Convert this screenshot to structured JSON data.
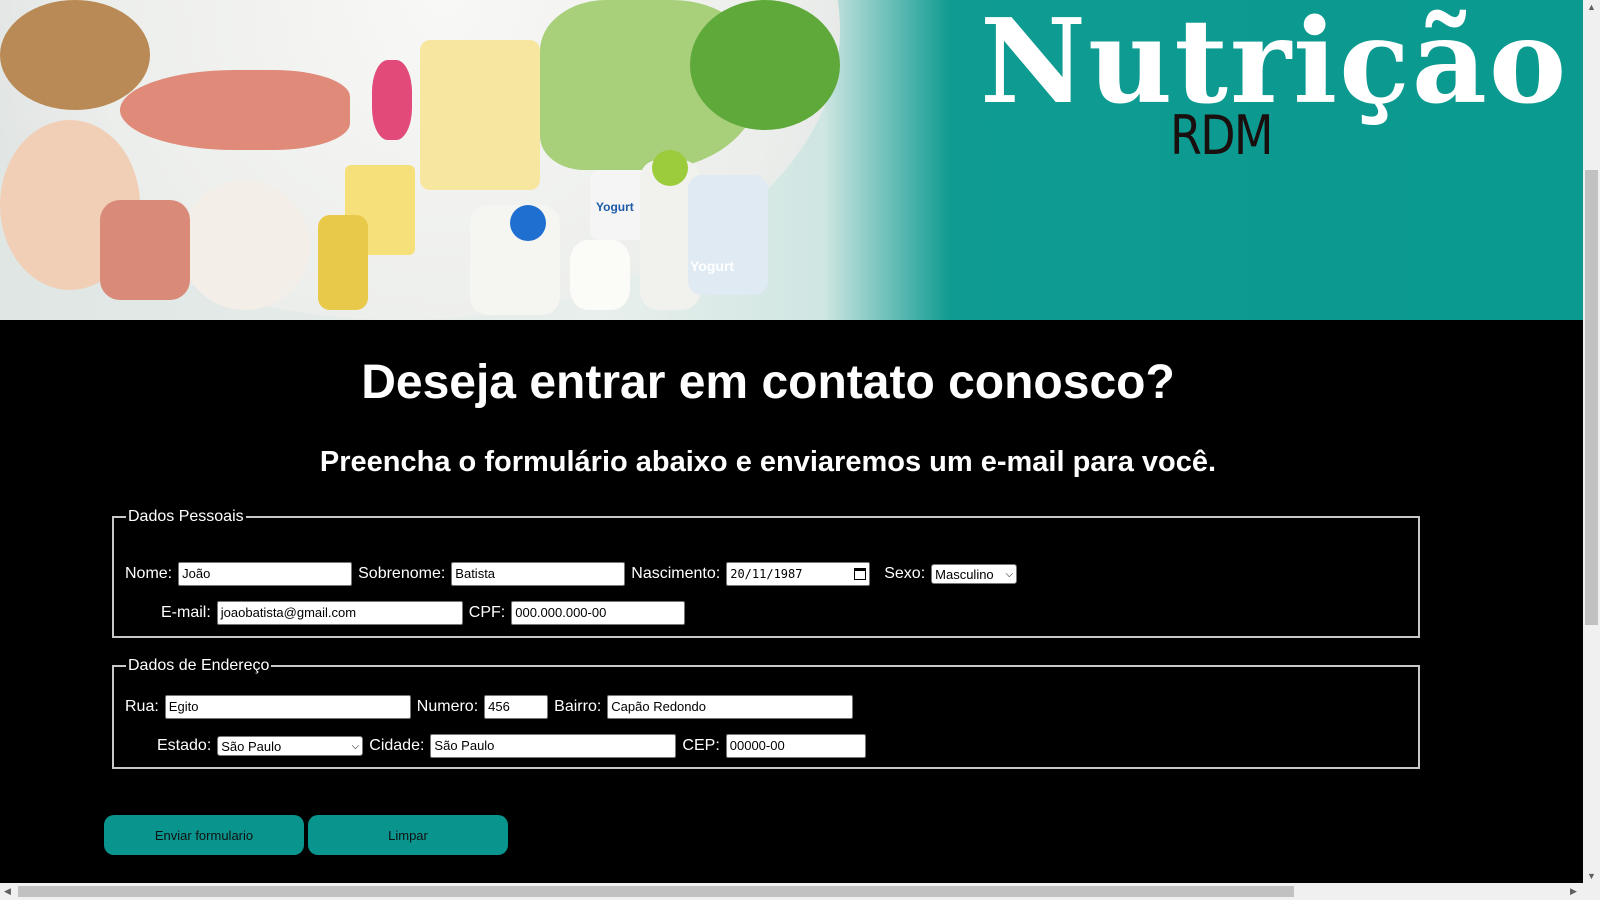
{
  "banner": {
    "title": "Nutrição",
    "subtitle": "RDM",
    "yogurt_label": "Yogurt"
  },
  "headings": {
    "main": "Deseja entrar em contato conosco?",
    "sub": "Preencha o formulário abaixo e enviaremos um e-mail para você."
  },
  "personal": {
    "legend": "Dados Pessoais",
    "nome_label": "Nome:",
    "nome_value": "João",
    "sobrenome_label": "Sobrenome:",
    "sobrenome_value": "Batista",
    "nascimento_label": "Nascimento:",
    "nascimento_value": "20/11/1987",
    "sexo_label": "Sexo:",
    "sexo_value": "Masculino",
    "email_label": "E-mail:",
    "email_value": "joaobatista@gmail.com",
    "cpf_label": "CPF:",
    "cpf_value": "000.000.000-00"
  },
  "address": {
    "legend": "Dados de Endereço",
    "rua_label": "Rua:",
    "rua_value": "Egito",
    "numero_label": "Numero:",
    "numero_value": "456",
    "bairro_label": "Bairro:",
    "bairro_value": "Capão Redondo",
    "estado_label": "Estado:",
    "estado_value": "São Paulo",
    "cidade_label": "Cidade:",
    "cidade_value": "São Paulo",
    "cep_label": "CEP:",
    "cep_value": "00000-00"
  },
  "buttons": {
    "submit": "Enviar formulario",
    "reset": "Limpar"
  },
  "icons": {
    "calendar": "calendar-icon",
    "select_chevron": "chevron-down-icon",
    "scroll_up": "arrow-up-icon",
    "scroll_down": "arrow-down-icon",
    "scroll_left": "arrow-left-icon",
    "scroll_right": "arrow-right-icon"
  },
  "colors": {
    "accent": "#09958d",
    "background": "#000000",
    "text": "#ffffff"
  }
}
